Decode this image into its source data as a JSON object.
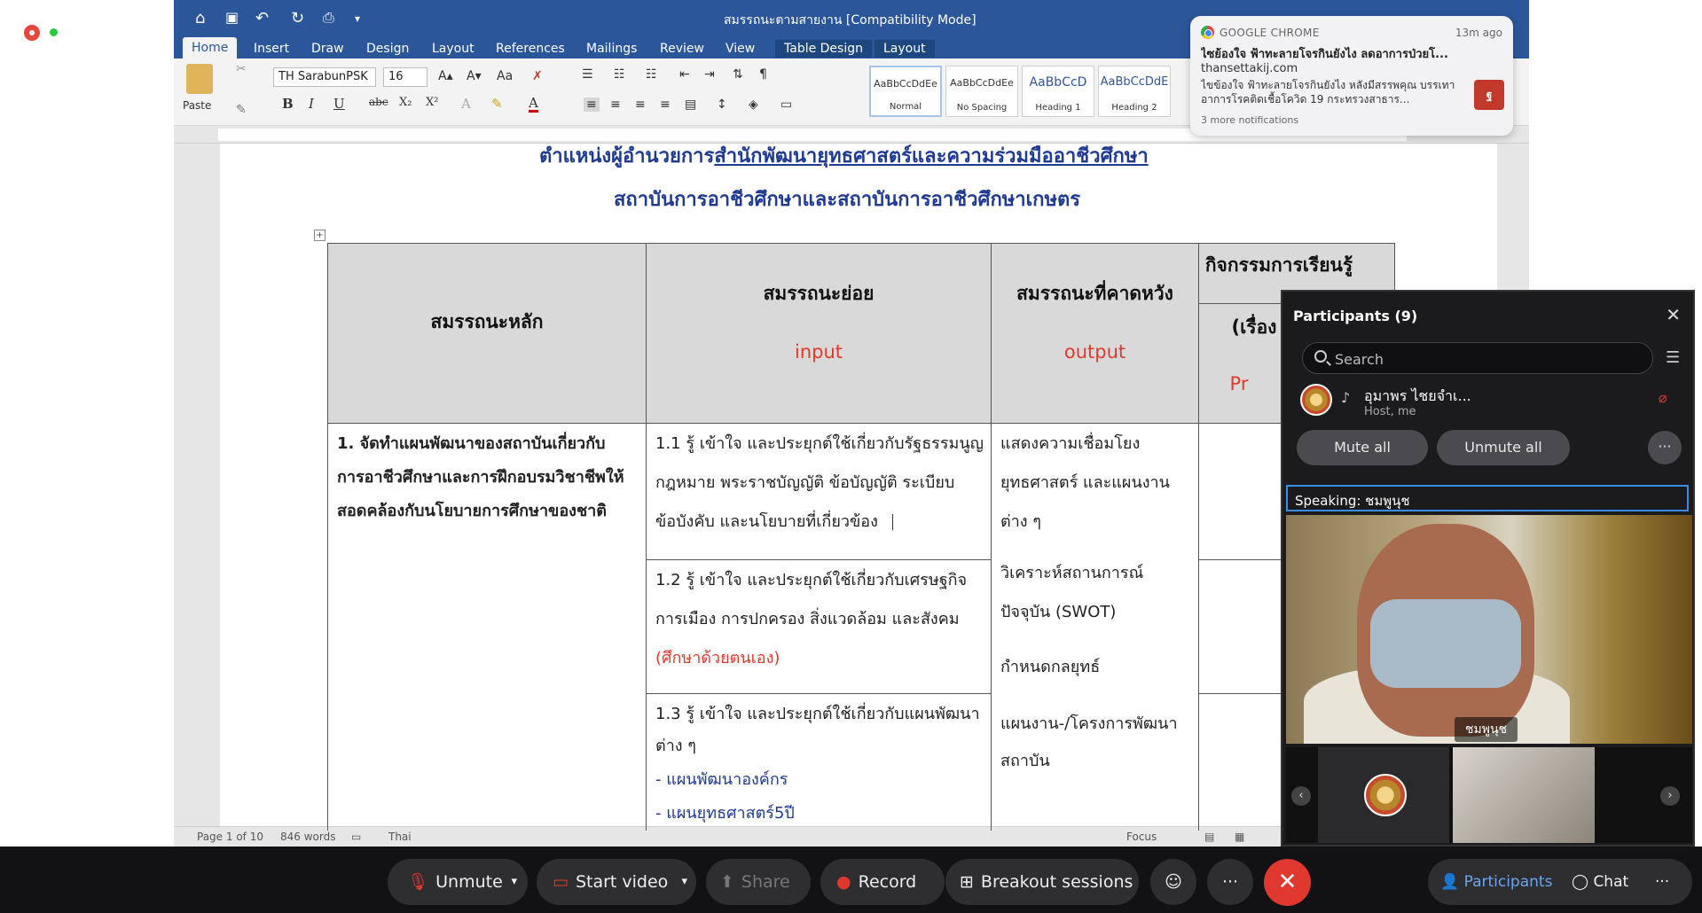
{
  "word": {
    "title": "สมรรถนะตามสายงาน [Compatibility Mode]",
    "tabs": [
      "Home",
      "Insert",
      "Draw",
      "Design",
      "Layout",
      "References",
      "Mailings",
      "Review",
      "View",
      "Table Design",
      "Layout"
    ],
    "paste_label": "Paste",
    "font_name": "TH SarabunPSK",
    "font_size": "16",
    "styles": [
      {
        "preview": "AaBbCcDdEe",
        "name": "Normal"
      },
      {
        "preview": "AaBbCcDdEe",
        "name": "No Spacing"
      },
      {
        "preview": "AaBbCcD",
        "name": "Heading 1"
      },
      {
        "preview": "AaBbCcDdE",
        "name": "Heading 2"
      }
    ],
    "status": {
      "page": "Page 1 of 10",
      "words": "846 words",
      "language": "Thai",
      "focus": "Focus"
    }
  },
  "document": {
    "title_line1_prefix": "ตำแหน่งผู้อำนวยการ",
    "title_line1_underlined": "สำนักพัฒนายุทธศาสตร์และความร่วมมืออาชีวศึกษา",
    "title_line2": "สถาบันการอาชีวศึกษาและสถาบันการอาชีวศึกษาเกษตร",
    "table": {
      "headers": {
        "col1": "สมรรถนะหลัก",
        "col2": "สมรรถนะย่อย",
        "col2_sub": "input",
        "col3": "สมรรถนะที่คาดหวัง",
        "col3_sub": "output",
        "col4": "กิจกรรมการเรียนรู้",
        "col4_sub": "(เรื่อง -",
        "col4_sub2": "Pr"
      },
      "main_competency": [
        "1. จัดทำแผนพัฒนาของสถาบันเกี่ยวกับ",
        "การอาชีวศึกษาและการฝึกอบรมวิชาชีพให้",
        "สอดคล้องกับนโยบายการศึกษาของชาติ"
      ],
      "sub_1_1": [
        "1.1 รู้ เข้าใจ และประยุกต์ใช้เกี่ยวกับรัฐธรรมนูญ",
        "กฎหมาย พระราชบัญญัติ ข้อบัญญัติ ระเบียบ",
        "ข้อบังคับ และนโยบายที่เกี่ยวข้อง"
      ],
      "sub_1_2": [
        "1.2 รู้ เข้าใจ และประยุกต์ใช้เกี่ยวกับเศรษฐกิจ",
        "การเมือง การปกครอง สิ่งแวดล้อม และสังคม"
      ],
      "sub_1_2_note": "(ศึกษาด้วยตนเอง)",
      "sub_1_3": [
        "1.3 รู้ เข้าใจ และประยุกต์ใช้เกี่ยวกับแผนพัฒนา",
        "ต่าง ๆ"
      ],
      "sub_1_3_items": [
        "- แผนพัฒนาองค์กร",
        "- แผนยุทธศาสตร์5ปี"
      ],
      "expected_1": [
        "แสดงความเชื่อมโยง",
        "ยุทธศาสตร์ และแผนงาน",
        "ต่าง ๆ"
      ],
      "expected_2": [
        "วิเคราะห์สถานการณ์",
        "ปัจจุบัน (SWOT)"
      ],
      "expected_3": "กำหนดกลยุทธ์",
      "expected_4": [
        "แผนงาน-/โครงการพัฒนา",
        "สถาบัน"
      ]
    }
  },
  "notification": {
    "source": "GOOGLE CHROME",
    "time": "13m ago",
    "headline": "ไซย้องใจ ฟ้าทะลายโจรกินยังไง ลดอาการป่วยโ...",
    "site": "thansettakij.com",
    "body": "ไขข้องใจ ฟ้าทะลายโจรกินยังไง หลังมีสรรพคุณ บรรเทาอาการโรคติดเชื้อโควิด 19  กระทรวงสาธาร...",
    "more": "3 more notifications"
  },
  "participants": {
    "title": "Participants (9)",
    "search_placeholder": "Search",
    "first_name": "อุมาพร ไชยจำเ...",
    "first_role": "Host, me",
    "mute_all": "Mute all",
    "unmute_all": "Unmute all",
    "more": "···",
    "speaking": "Speaking: ชมพูนุช",
    "video_label": "ชมพูนุช"
  },
  "toolbar": {
    "unmute": "Unmute",
    "start_video": "Start video",
    "share": "Share",
    "record": "Record",
    "breakout": "Breakout sessions",
    "more": "···",
    "participants": "Participants",
    "chat": "Chat",
    "more_right": "···"
  },
  "colors": {
    "word_blue": "#2b579a",
    "doc_title_blue": "#1f3a93",
    "accent_red": "#e03a2f",
    "end_red": "#e0382e",
    "speaking_border": "#3a8ee6"
  }
}
